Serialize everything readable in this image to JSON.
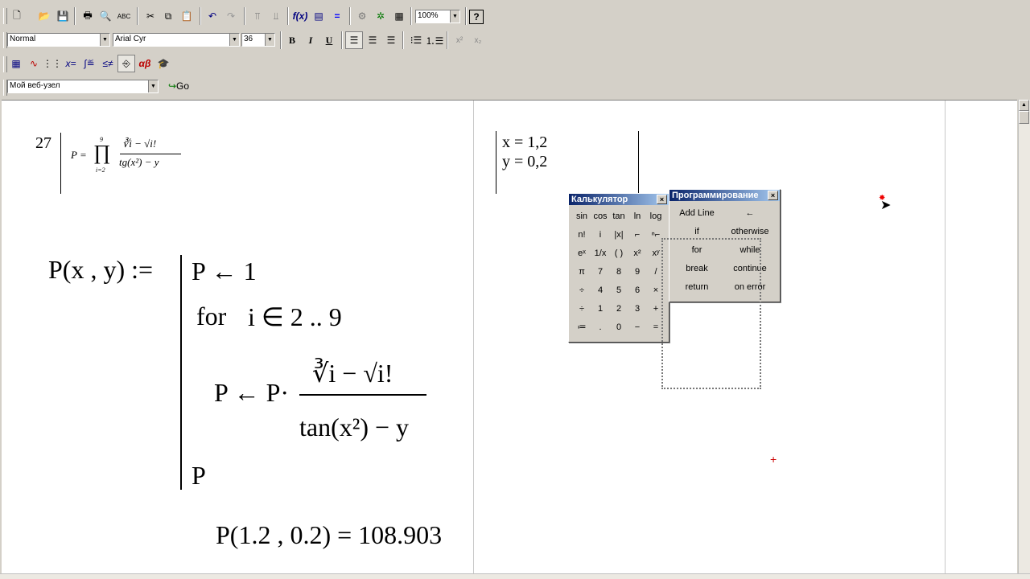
{
  "toolbar": {
    "style_value": "Normal",
    "font_value": "Arial Cyr",
    "size_value": "36",
    "zoom_value": "100%",
    "bold_label": "B",
    "italic_label": "I",
    "underline_label": "U",
    "web_value": "Мой веб-узел",
    "go_label": "Go"
  },
  "worksheet": {
    "eq_number": "27",
    "small_formula": {
      "lhs": "P =",
      "prod_upper": "9",
      "prod_lower": "i=2",
      "numerator": "∛i − √i!",
      "denominator": "tg(x²) − y"
    },
    "vars": [
      "x = 1,2",
      "y = 0,2"
    ],
    "program": {
      "definition": "P(x , y) :=",
      "line1": "P ← 1",
      "line2_for": "for",
      "line2_range": "i ∈ 2 .. 9",
      "line3_lhs": "P ← P·",
      "line3_num": "∛i − √i!",
      "line3_den": "tan(x²) − y",
      "line4": "P"
    },
    "result": "P(1.2 , 0.2) = 108.903"
  },
  "calculator": {
    "title": "Калькулятор",
    "rows": [
      [
        "sin",
        "cos",
        "tan",
        "ln",
        "log"
      ],
      [
        "n!",
        "i",
        "|x|",
        "⌐",
        "ⁿ⌐"
      ],
      [
        "eˣ",
        "1/x",
        "( )",
        "x²",
        "xʸ"
      ],
      [
        "π",
        "7",
        "8",
        "9",
        "/"
      ],
      [
        "÷",
        "4",
        "5",
        "6",
        "×"
      ],
      [
        "÷",
        "1",
        "2",
        "3",
        "+"
      ],
      [
        "≔",
        ".",
        "0",
        "−",
        "="
      ]
    ]
  },
  "programming": {
    "title": "Программирование",
    "buttons": [
      [
        "Add Line",
        "←"
      ],
      [
        "if",
        "otherwise"
      ],
      [
        "for",
        "while"
      ],
      [
        "break",
        "continue"
      ],
      [
        "return",
        "on error"
      ]
    ]
  }
}
